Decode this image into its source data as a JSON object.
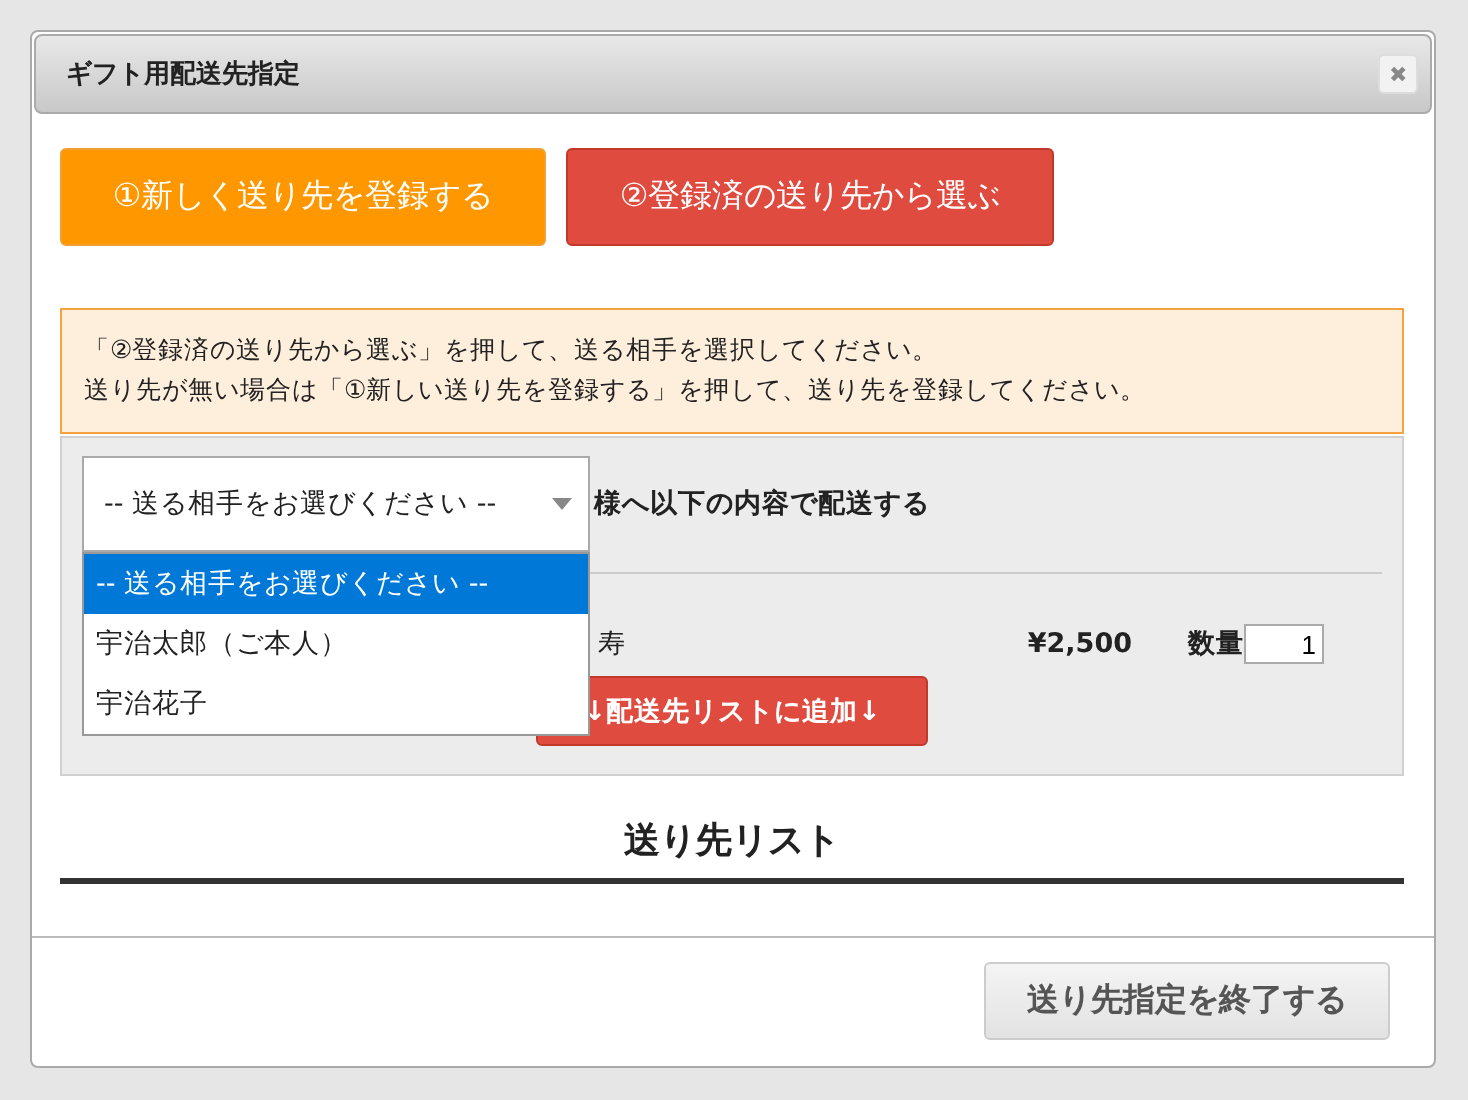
{
  "dialog": {
    "title": "ギフト用配送先指定",
    "close": "✖"
  },
  "mode_buttons": [
    {
      "label": "①新しく送り先を登録する",
      "kind": "new"
    },
    {
      "label": "②登録済の送り先から選ぶ",
      "kind": "existing"
    }
  ],
  "notice": [
    "「②登録済の送り先から選ぶ」を押して、送る相手を選択してください。",
    "送り先が無い場合は「①新しい送り先を登録する」を押して、送り先を登録してください。"
  ],
  "recipient_select": {
    "value": "-- 送る相手をお選びください --",
    "expanded": true,
    "options": [
      {
        "label": "-- 送る相手をお選びください --",
        "selected": true
      },
      {
        "label": "宇治太郎（ご本人）",
        "selected": false
      },
      {
        "label": "宇治花子",
        "selected": false
      }
    ]
  },
  "send_label": "様へ以下の内容で配送する",
  "product": {
    "name": "寿",
    "price": "¥2,500",
    "qty_label": "数量",
    "qty": "1"
  },
  "add_button": "↓配送先リストに追加↓",
  "list_heading": "送り先リスト",
  "finish_button": "送り先指定を終了する"
}
